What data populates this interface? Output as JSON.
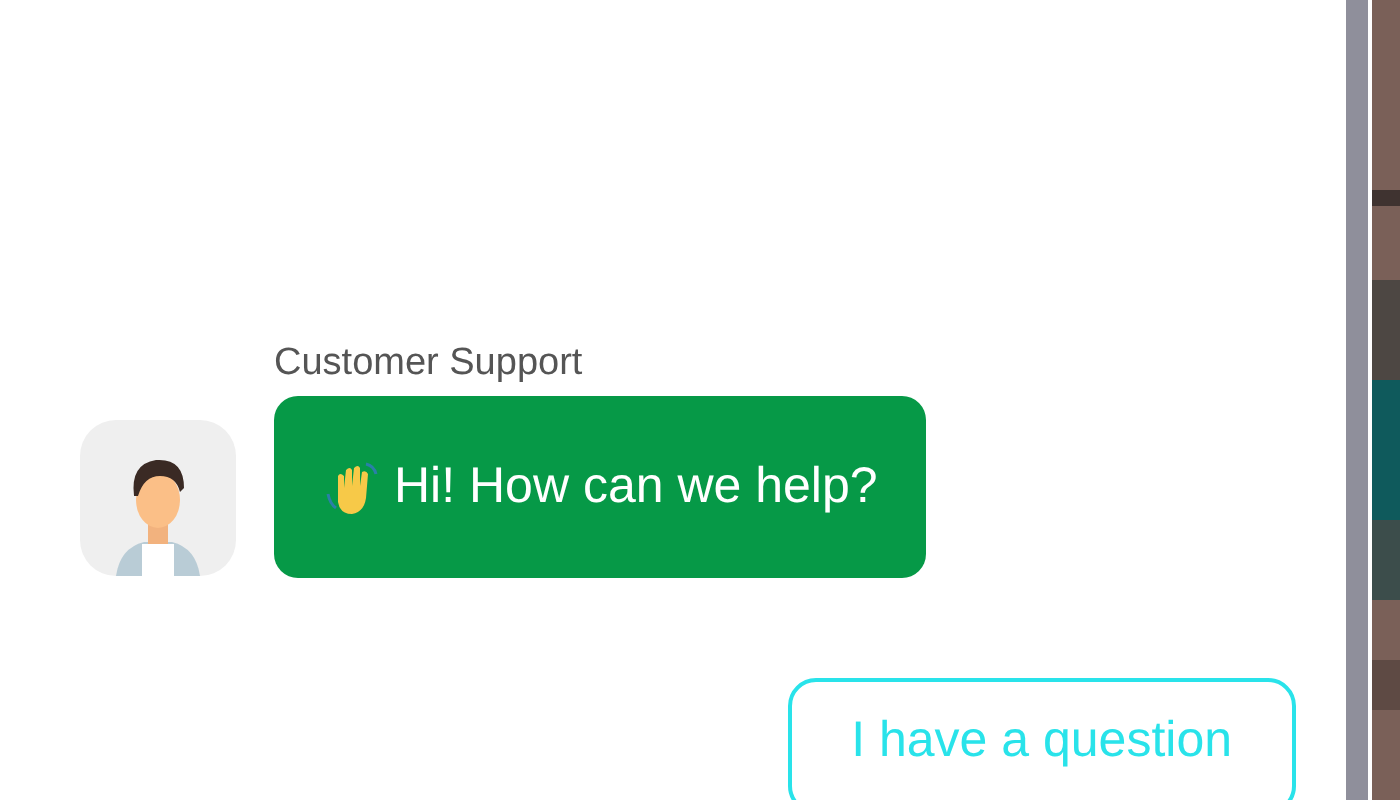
{
  "messages": [
    {
      "sender": "Customer Support",
      "text": "Hi! How can we help?"
    }
  ],
  "quick_replies": [
    {
      "label": "I have a question"
    }
  ]
}
